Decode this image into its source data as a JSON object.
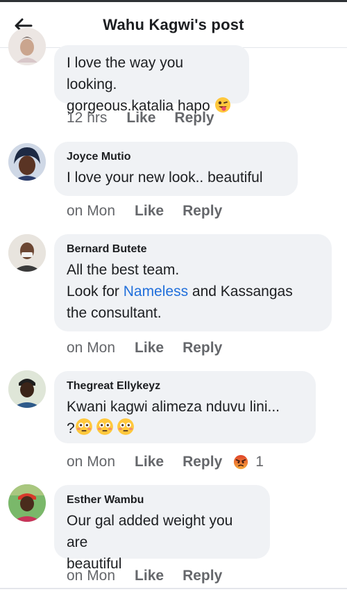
{
  "header": {
    "title": "Wahu Kagwi's post"
  },
  "icons": {
    "back": "arrow-left-icon",
    "emoji_tongue": "winking-tongue-face",
    "emoji_flushed": "flushed-face",
    "emoji_angry": "angry-face"
  },
  "colors": {
    "bubble": "#f0f2f5",
    "meta": "#65676b",
    "mention": "#216fdb",
    "angry": "#e44b23"
  },
  "comments": [
    {
      "author": "",
      "lines": [
        "I love the way you looking.",
        "gorgeous.katalia hapo"
      ],
      "time": "12 hrs",
      "like": "Like",
      "reply": "Reply"
    },
    {
      "author": "Joyce Mutio",
      "lines": [
        "I love your new look.. beautiful"
      ],
      "time": "on Mon",
      "like": "Like",
      "reply": "Reply"
    },
    {
      "author": "Bernard Butete",
      "line1": "All the best team.",
      "line2_pre": "Look for ",
      "line2_mention": "Nameless",
      "line2_post": " and Kassangas",
      "line3": "the consultant.",
      "time": "on Mon",
      "like": "Like",
      "reply": "Reply"
    },
    {
      "author": "Thegreat Ellykeyz",
      "lines": [
        "Kwani kagwi alimeza nduvu lini...",
        "?"
      ],
      "time": "on Mon",
      "like": "Like",
      "reply": "Reply",
      "reaction_count": "1"
    },
    {
      "author": "Esther Wambu",
      "lines": [
        "Our gal added weight you are",
        "beautiful"
      ],
      "time": "on Mon",
      "like": "Like",
      "reply": "Reply"
    }
  ]
}
